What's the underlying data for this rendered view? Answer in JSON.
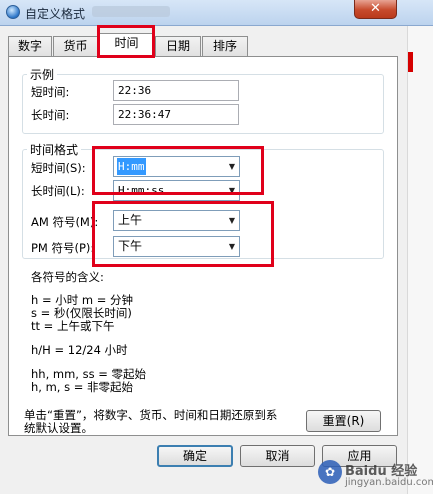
{
  "window": {
    "title": "自定义格式",
    "close_glyph": "✕"
  },
  "tabs": [
    {
      "label": "数字"
    },
    {
      "label": "货币"
    },
    {
      "label": "时间",
      "active": true
    },
    {
      "label": "日期"
    },
    {
      "label": "排序"
    }
  ],
  "example": {
    "title": "示例",
    "short_label": "短时间:",
    "short_value": "22:36",
    "long_label": "长时间:",
    "long_value": "22:36:47"
  },
  "time_format": {
    "title": "时间格式",
    "short_label": "短时间(S):",
    "short_value": "H:mm",
    "long_label": "长时间(L):",
    "long_value": "H:mm:ss",
    "am_label": "AM 符号(M):",
    "am_value": "上午",
    "pm_label": "PM 符号(P):",
    "pm_value": "下午"
  },
  "help": {
    "title": "各符号的含义:",
    "line1": "h = 小时   m = 分钟",
    "line2": "s = 秒(仅限长时间)",
    "line3": "tt = 上午或下午",
    "line4": "h/H = 12/24 小时",
    "line5": "hh, mm, ss = 零起始",
    "line6": "h, m, s = 非零起始"
  },
  "reset": {
    "text_line1": "单击“重置”，将数字、货币、时间和日期还原到系",
    "text_line2": "统默认设置。",
    "button": "重置(R)"
  },
  "buttons": {
    "ok": "确定",
    "cancel": "取消",
    "apply": "应用"
  },
  "watermark": {
    "text": "Baidu 经验",
    "sub": "jingyan.baidu.com",
    "icon": "paw-icon"
  },
  "colors": {
    "highlight_box": "#e0001a",
    "selection": "#3399ff",
    "close_button": "#c74a2c"
  }
}
